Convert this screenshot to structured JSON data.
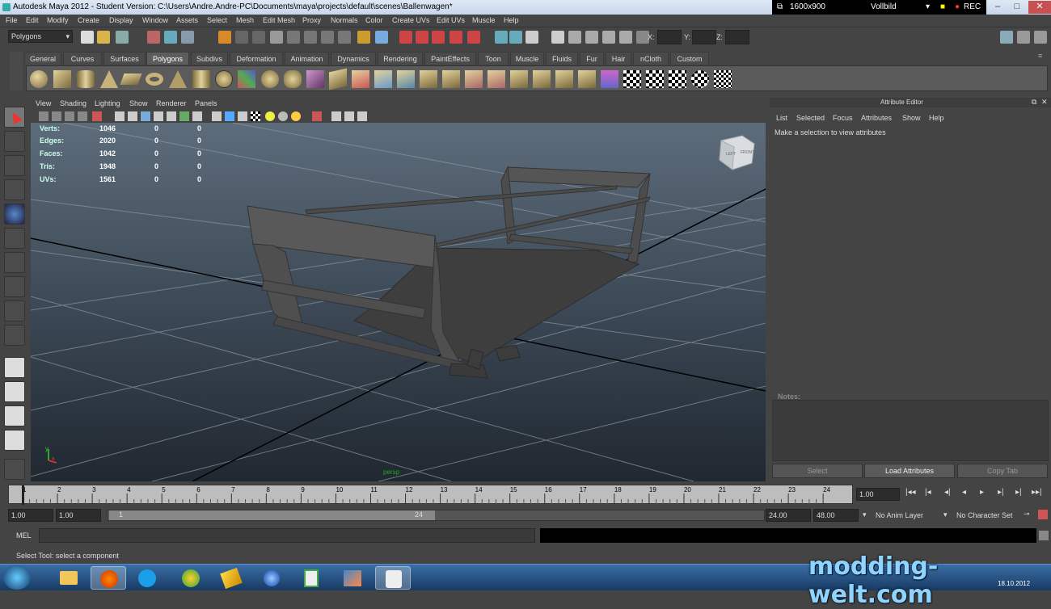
{
  "window": {
    "title": "Autodesk Maya 2012 - Student Version: C:\\Users\\Andre.Andre-PC\\Documents\\maya\\projects\\default\\scenes\\Ballenwagen*",
    "minimize": "–",
    "maximize": "□",
    "close": "✕"
  },
  "recorder": {
    "resolution": "1600x900",
    "mode": "Vollbild",
    "rec": "REC"
  },
  "menus": [
    "File",
    "Edit",
    "Modify",
    "Create",
    "Display",
    "Window",
    "Assets",
    "Select",
    "Mesh",
    "Edit Mesh",
    "Proxy",
    "Normals",
    "Color",
    "Create UVs",
    "Edit UVs",
    "Muscle",
    "Help"
  ],
  "statusline": {
    "menuset": "Polygons",
    "x_label": "X:",
    "y_label": "Y:",
    "z_label": "Z:"
  },
  "shelf_tabs": [
    "General",
    "Curves",
    "Surfaces",
    "Polygons",
    "Subdivs",
    "Deformation",
    "Animation",
    "Dynamics",
    "Rendering",
    "PaintEffects",
    "Toon",
    "Muscle",
    "Fluids",
    "Fur",
    "Hair",
    "nCloth",
    "Custom"
  ],
  "active_shelf_tab": "Polygons",
  "viewport_menu": [
    "View",
    "Shading",
    "Lighting",
    "Show",
    "Renderer",
    "Panels"
  ],
  "hud": {
    "rows": [
      {
        "label": "Verts:",
        "a": "1046",
        "b": "0",
        "c": "0"
      },
      {
        "label": "Edges:",
        "a": "2020",
        "b": "0",
        "c": "0"
      },
      {
        "label": "Faces:",
        "a": "1042",
        "b": "0",
        "c": "0"
      },
      {
        "label": "Tris:",
        "a": "1948",
        "b": "0",
        "c": "0"
      },
      {
        "label": "UVs:",
        "a": "1561",
        "b": "0",
        "c": "0"
      }
    ],
    "camera": "persp",
    "cube_left": "LEFT",
    "cube_front": "FRONT",
    "axis_y": "y",
    "axis_x": "x"
  },
  "attribute_editor": {
    "title": "Attribute Editor",
    "menu": [
      "List",
      "Selected",
      "Focus",
      "Attributes",
      "Show",
      "Help"
    ],
    "message": "Make a selection to view attributes",
    "notes_label": "Notes:",
    "buttons": {
      "select": "Select",
      "load": "Load Attributes",
      "copy": "Copy Tab"
    }
  },
  "timeline": {
    "ticks": [
      "1",
      "2",
      "3",
      "4",
      "5",
      "6",
      "7",
      "8",
      "9",
      "10",
      "11",
      "12",
      "13",
      "14",
      "15",
      "16",
      "17",
      "18",
      "19",
      "20",
      "21",
      "22",
      "23",
      "24"
    ],
    "current_time": "1.00"
  },
  "range": {
    "start": "1.00",
    "playback_start": "1.00",
    "slider_start": "1",
    "slider_end": "24",
    "playback_end": "24.00",
    "end": "48.00",
    "anim_layer": "No Anim Layer",
    "character_set": "No Character Set"
  },
  "command": {
    "label": "MEL"
  },
  "helpline": "Select Tool: select a component",
  "taskbar": {
    "clock": "18.10.2012"
  },
  "watermark": "modding-welt.com"
}
